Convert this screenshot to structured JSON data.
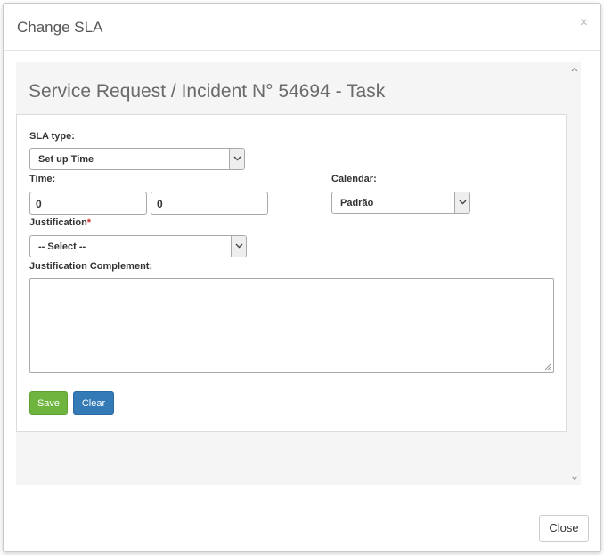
{
  "modal": {
    "title": "Change SLA",
    "close_glyph": "×"
  },
  "page": {
    "heading": "Service Request / Incident N°  54694 - Task"
  },
  "form": {
    "sla_type": {
      "label": "SLA type:",
      "value": "Set up Time"
    },
    "time": {
      "label": "Time:",
      "hours": "0",
      "minutes": "0"
    },
    "calendar": {
      "label": "Calendar:",
      "value": "Padrão"
    },
    "justification": {
      "label": "Justification",
      "required_mark": "*",
      "value": "-- Select --"
    },
    "justification_complement": {
      "label": "Justification Complement:",
      "value": ""
    },
    "save_label": "Save",
    "clear_label": "Clear"
  },
  "footer": {
    "close_label": "Close"
  },
  "colors": {
    "save": "#6eb43f",
    "clear": "#337ab7",
    "required": "#c9302c"
  }
}
